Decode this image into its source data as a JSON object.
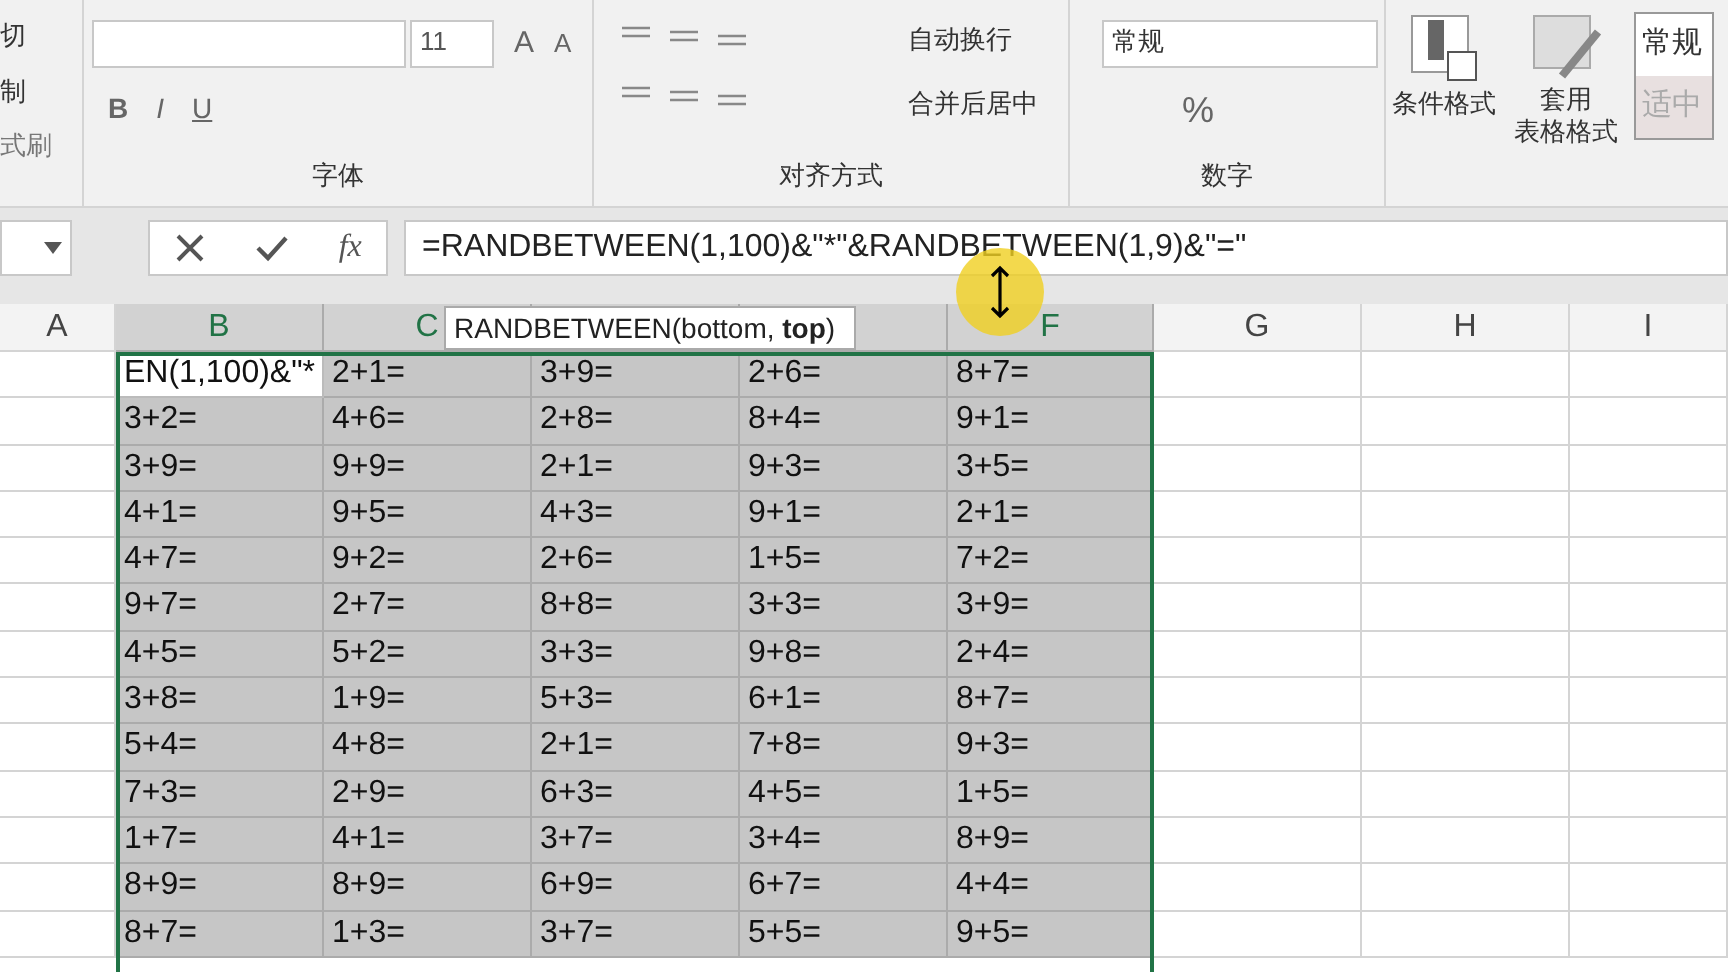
{
  "ribbon": {
    "clipboard": {
      "items": [
        "切",
        "制",
        "式刷"
      ]
    },
    "font": {
      "font_size": "11",
      "size_buttons": [
        "A",
        "A"
      ],
      "style_buttons": [
        "B",
        "I",
        "U"
      ],
      "label": "字体"
    },
    "alignment": {
      "wrap_text": "自动换行",
      "merge_center": "合并后居中",
      "label": "对齐方式"
    },
    "number": {
      "format": "常规",
      "percent": "%",
      "label": "数字"
    },
    "styles": {
      "conditional_format": "条件格式",
      "format_table": [
        "套用",
        "表格格式"
      ],
      "cell_styles": [
        "常规",
        "适中"
      ]
    }
  },
  "formula_bar": {
    "fx": "fx",
    "formula": "=RANDBETWEEN(1,100)&\"*\"&RANDBETWEEN(1,9)&\"=\""
  },
  "tooltip": "RANDBETWEEN(bottom, **top**)",
  "columns": [
    {
      "label": "A",
      "selected": false
    },
    {
      "label": "B",
      "selected": true
    },
    {
      "label": "C",
      "selected": true
    },
    {
      "selected": true
    },
    {
      "selected": true
    },
    {
      "label": "F",
      "selected": true
    },
    {
      "label": "G",
      "selected": false
    },
    {
      "label": "H",
      "selected": false
    },
    {
      "label": "I",
      "selected": false
    }
  ],
  "rows": [
    [
      "EN(1,100)&\"*",
      "2+1=",
      "3+9=",
      "2+6=",
      "8+7="
    ],
    [
      "3+2=",
      "4+6=",
      "2+8=",
      "8+4=",
      "9+1="
    ],
    [
      "3+9=",
      "9+9=",
      "2+1=",
      "9+3=",
      "3+5="
    ],
    [
      "4+1=",
      "9+5=",
      "4+3=",
      "9+1=",
      "2+1="
    ],
    [
      "4+7=",
      "9+2=",
      "2+6=",
      "1+5=",
      "7+2="
    ],
    [
      "9+7=",
      "2+7=",
      "8+8=",
      "3+3=",
      "3+9="
    ],
    [
      "4+5=",
      "5+2=",
      "3+3=",
      "9+8=",
      "2+4="
    ],
    [
      "3+8=",
      "1+9=",
      "5+3=",
      "6+1=",
      "8+7="
    ],
    [
      "5+4=",
      "4+8=",
      "2+1=",
      "7+8=",
      "9+3="
    ],
    [
      "7+3=",
      "2+9=",
      "6+3=",
      "4+5=",
      "1+5="
    ],
    [
      "1+7=",
      "4+1=",
      "3+7=",
      "3+4=",
      "8+9="
    ],
    [
      "8+9=",
      "8+9=",
      "6+9=",
      "6+7=",
      "4+4="
    ],
    [
      "8+7=",
      "1+3=",
      "3+7=",
      "5+5=",
      "9+5="
    ]
  ]
}
